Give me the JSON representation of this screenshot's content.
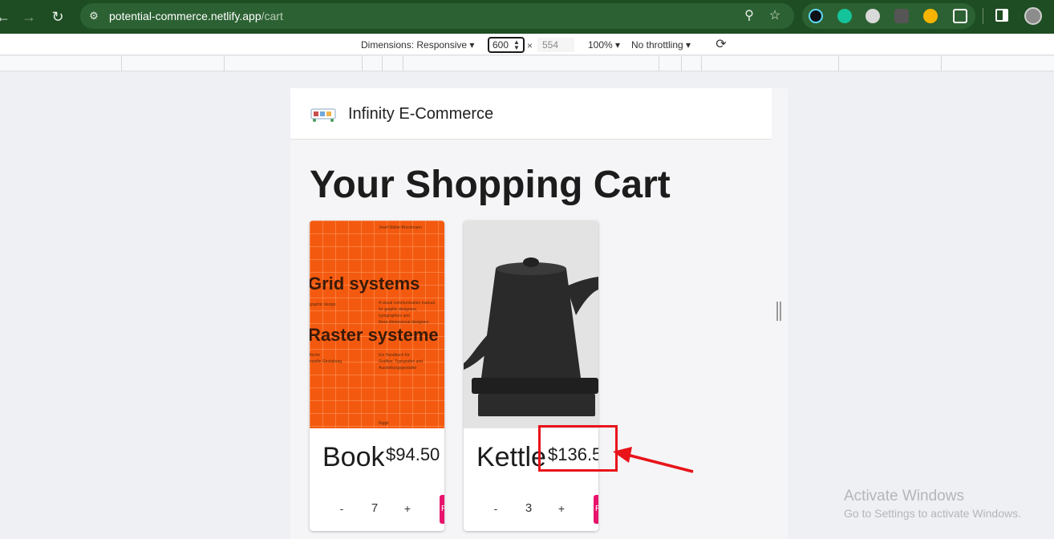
{
  "browser": {
    "url_host": "potential-commerce.netlify.app",
    "url_path": "/cart"
  },
  "devtools": {
    "dimensions_label": "Dimensions: Responsive",
    "width_value": "600",
    "times": "×",
    "height_value": "554",
    "zoom_label": "100%",
    "throttle_label": "No throttling"
  },
  "app": {
    "brand": "Infinity E-Commerce",
    "page_title": "Your Shopping Cart"
  },
  "cart": {
    "items": [
      {
        "name": "Book",
        "price": "$94.50",
        "quantity": "7",
        "decrement": "-",
        "increment": "+",
        "remove": "R",
        "cover_title_1": "Grid systems",
        "cover_title_2": "Raster systeme"
      },
      {
        "name": "Kettle",
        "price": "$136.5",
        "quantity": "3",
        "decrement": "-",
        "increment": "+",
        "remove": "R"
      }
    ]
  },
  "windows": {
    "activate_title": "Activate Windows",
    "activate_sub": "Go to Settings to activate Windows."
  },
  "colors": {
    "browser_bar": "#1e4d23",
    "accent_remove": "#e8136c",
    "annotation": "#e8141a",
    "book_cover": "#f45a0f"
  }
}
